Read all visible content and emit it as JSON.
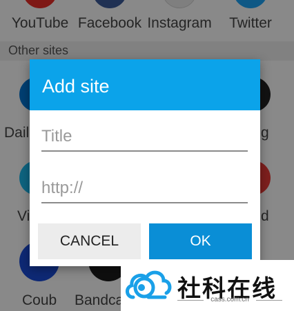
{
  "top_sites": [
    {
      "label": "YouTube",
      "color": "#e52d27"
    },
    {
      "label": "Facebook",
      "color": "#3b5998"
    },
    {
      "label": "Instagram",
      "color": "#dddddd"
    },
    {
      "label": "Twitter",
      "color": "#1da1f2"
    }
  ],
  "section": {
    "label": "Other sites"
  },
  "middle_sites": [
    {
      "label": "Dail",
      "color": "#0073cf"
    },
    {
      "label": "g",
      "color": "#222222"
    }
  ],
  "lower_sites": [
    {
      "label": "Vi",
      "color": "#1ab7ea"
    },
    {
      "label": "d",
      "color": "#e53935"
    }
  ],
  "bottom_sites": [
    {
      "label": "Coub",
      "color": "#1a4bd6"
    },
    {
      "label": "Bandca",
      "color": "#1d1d1d"
    }
  ],
  "dialog": {
    "title": "Add site",
    "title_placeholder": "Title",
    "url_placeholder": "http://",
    "cancel_label": "CANCEL",
    "ok_label": "OK",
    "header_color": "#0ba3ea"
  },
  "watermark": {
    "text": "社科在线",
    "sub": "cass.com.cn"
  }
}
